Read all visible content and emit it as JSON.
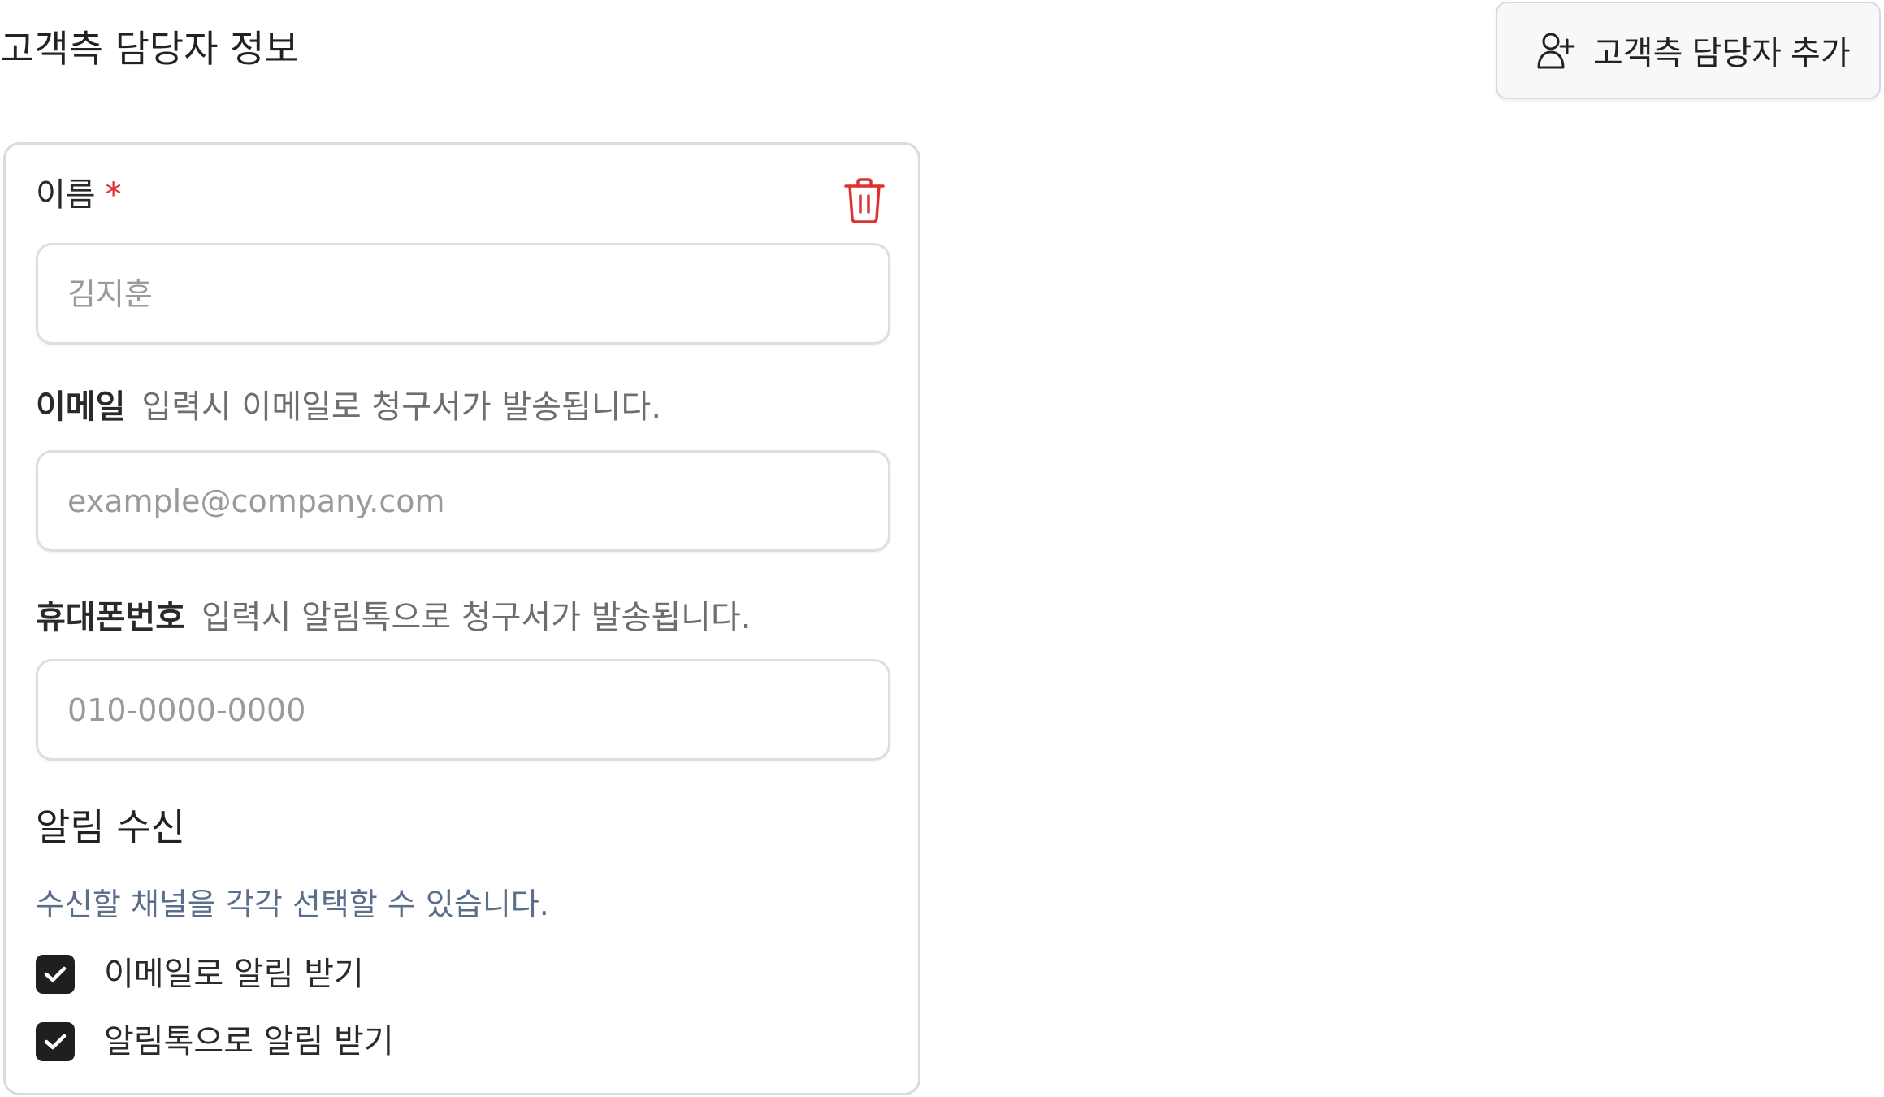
{
  "header": {
    "title": "고객측 담당자 정보",
    "add_button_label": "고객측 담당자 추가"
  },
  "contact_card": {
    "name": {
      "label": "이름",
      "required_mark": "*",
      "placeholder": "김지훈",
      "value": ""
    },
    "email": {
      "label": "이메일",
      "hint": "입력시 이메일로 청구서가 발송됩니다.",
      "placeholder": "example@company.com",
      "value": ""
    },
    "phone": {
      "label": "휴대폰번호",
      "hint": "입력시 알림톡으로 청구서가 발송됩니다.",
      "placeholder": "010-0000-0000",
      "value": ""
    },
    "notifications": {
      "title": "알림 수신",
      "description": "수신할 채널을 각각 선택할 수 있습니다.",
      "options": [
        {
          "label": "이메일로 알림 받기",
          "checked": true
        },
        {
          "label": "알림톡으로 알림 받기",
          "checked": true
        }
      ]
    },
    "delete_icon": "trash-icon"
  },
  "colors": {
    "required": "#e03131",
    "delete": "#e03131",
    "description": "#5b6f8d",
    "checkbox": "#1f1f1f"
  }
}
